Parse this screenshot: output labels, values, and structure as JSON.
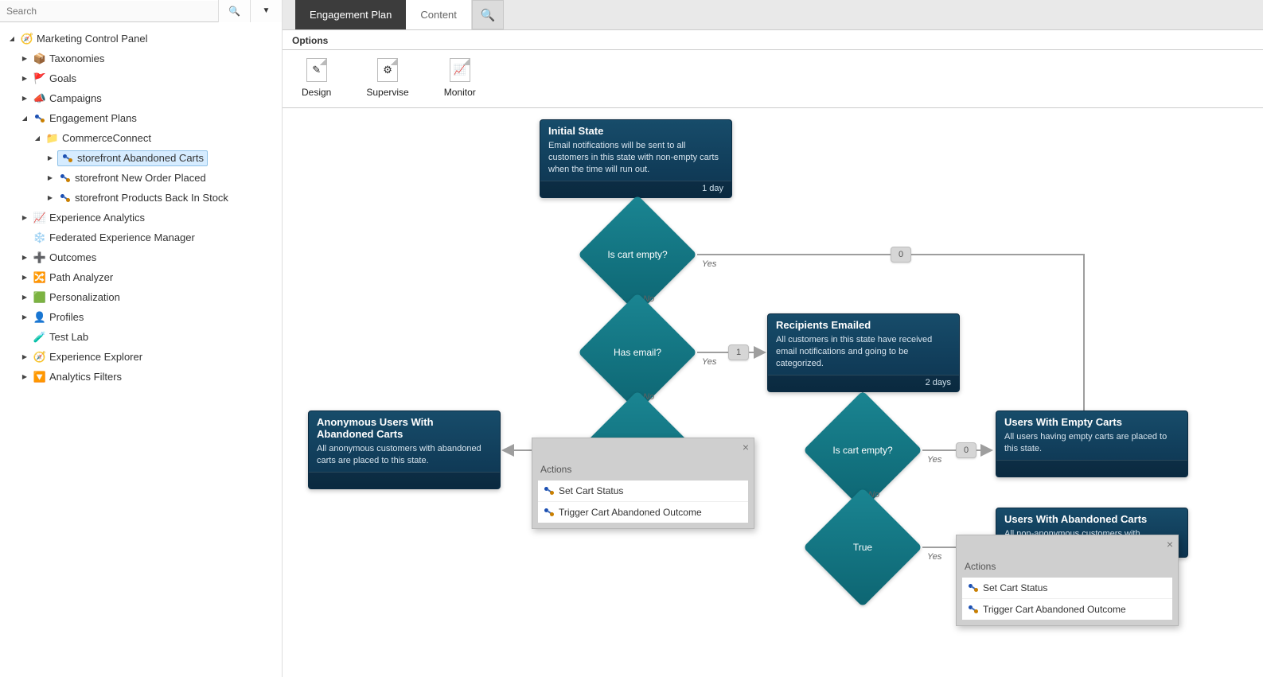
{
  "sidebar": {
    "search_placeholder": "Search",
    "tree": {
      "root": "Marketing Control Panel",
      "items": [
        {
          "label": "Taxonomies",
          "icon": "📦",
          "indent": 1,
          "arrow": "right"
        },
        {
          "label": "Goals",
          "icon": "🚩",
          "indent": 1,
          "arrow": "right"
        },
        {
          "label": "Campaigns",
          "icon": "📣",
          "indent": 1,
          "arrow": "right"
        },
        {
          "label": "Engagement Plans",
          "icon": "plan",
          "indent": 1,
          "arrow": "down"
        },
        {
          "label": "CommerceConnect",
          "icon": "📁",
          "indent": 2,
          "arrow": "down"
        },
        {
          "label": "storefront Abandoned Carts",
          "icon": "plan",
          "indent": 3,
          "arrow": "right",
          "selected": true
        },
        {
          "label": "storefront New Order Placed",
          "icon": "plan",
          "indent": 3,
          "arrow": "right"
        },
        {
          "label": "storefront Products Back In Stock",
          "icon": "plan",
          "indent": 3,
          "arrow": "right"
        },
        {
          "label": "Experience Analytics",
          "icon": "📈",
          "indent": 1,
          "arrow": "right"
        },
        {
          "label": "Federated Experience Manager",
          "icon": "❄️",
          "indent": 1,
          "arrow": "blank"
        },
        {
          "label": "Outcomes",
          "icon": "➕",
          "indent": 1,
          "arrow": "right"
        },
        {
          "label": "Path Analyzer",
          "icon": "🔀",
          "indent": 1,
          "arrow": "right"
        },
        {
          "label": "Personalization",
          "icon": "🟩",
          "indent": 1,
          "arrow": "right"
        },
        {
          "label": "Profiles",
          "icon": "👤",
          "indent": 1,
          "arrow": "right"
        },
        {
          "label": "Test Lab",
          "icon": "🧪",
          "indent": 1,
          "arrow": "blank"
        },
        {
          "label": "Experience Explorer",
          "icon": "🧭",
          "indent": 1,
          "arrow": "right"
        },
        {
          "label": "Analytics Filters",
          "icon": "🔽",
          "indent": 1,
          "arrow": "right"
        }
      ]
    }
  },
  "tabs": {
    "active": "Engagement Plan",
    "inactive": "Content"
  },
  "options_label": "Options",
  "toolbar": {
    "design": "Design",
    "supervise": "Supervise",
    "monitor": "Monitor"
  },
  "nodes": {
    "initial": {
      "title": "Initial State",
      "desc": "Email notifications will be sent to all customers in this state with non-empty carts when the time will run out.",
      "footer": "1 day"
    },
    "recipients": {
      "title": "Recipients Emailed",
      "desc": "All customers in this state have received email notifications and going to be categorized.",
      "footer": "2 days"
    },
    "anon": {
      "title": "Anonymous Users With Abandoned Carts",
      "desc": "All anonymous customers with abandoned carts are placed to this state."
    },
    "empty": {
      "title": "Users With Empty Carts",
      "desc": "All users having empty carts are placed to this state."
    },
    "abandoned": {
      "title": "Users With Abandoned Carts",
      "desc": "All non-anonymous customers with abandoned"
    }
  },
  "diamonds": {
    "is_cart_empty": "Is cart empty?",
    "has_email": "Has email?",
    "is_cart_empty2": "Is cart empty?",
    "true": "True"
  },
  "edge_labels": {
    "yes": "Yes",
    "no": "No"
  },
  "pills": {
    "zero": "0",
    "one": "1",
    "zero2": "0"
  },
  "popup": {
    "title": "Actions",
    "items": [
      "Set Cart Status",
      "Trigger Cart Abandoned Outcome"
    ]
  }
}
